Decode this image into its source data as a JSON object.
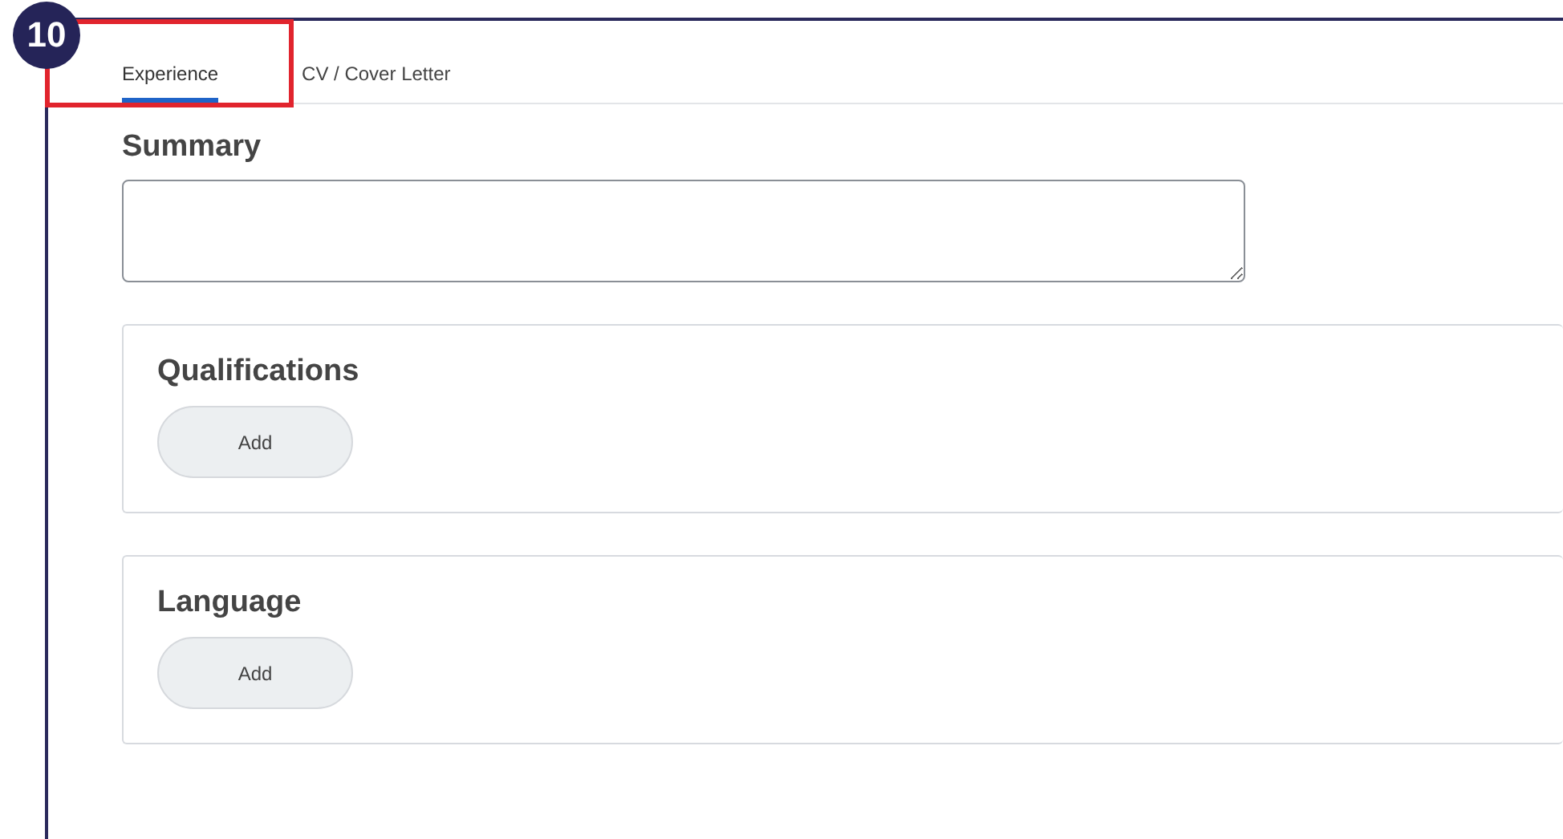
{
  "callout": {
    "number": "10"
  },
  "tabs": [
    {
      "label": "Experience",
      "selected": true,
      "highlighted": true
    },
    {
      "label": "CV / Cover Letter",
      "selected": false,
      "highlighted": false
    }
  ],
  "summary": {
    "label": "Summary"
  },
  "sections": [
    {
      "title": "Qualifications",
      "button": "Add"
    },
    {
      "title": "Language",
      "button": "Add"
    }
  ]
}
